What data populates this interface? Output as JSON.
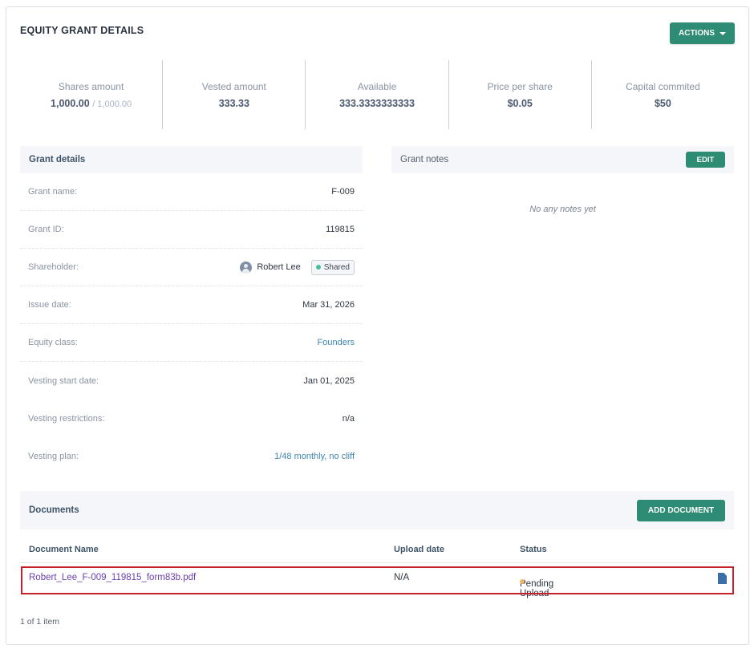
{
  "card": {
    "title": "EQUITY GRANT DETAILS",
    "actions_label": "ACTIONS"
  },
  "stats": [
    {
      "label": "Shares amount",
      "value": "1,000.00",
      "sub": "/ 1,000.00"
    },
    {
      "label": "Vested amount",
      "value": "333.33"
    },
    {
      "label": "Available",
      "value": "333.3333333333"
    },
    {
      "label": "Price per share",
      "value": "$0.05"
    },
    {
      "label": "Capital commited",
      "value": "$50"
    }
  ],
  "grant_details": {
    "title": "Grant details",
    "rows": [
      {
        "label": "Grant name:",
        "value": "F-009"
      },
      {
        "label": "Grant ID:",
        "value": "119815"
      },
      {
        "label": "Shareholder:",
        "value": "Robert Lee",
        "badge": "Shared"
      },
      {
        "label": "Issue date:",
        "value": "Mar 31, 2026"
      },
      {
        "label": "Equity class:",
        "value": "Founders"
      },
      {
        "label": "Vesting start date:",
        "value": "Jan 01, 2025"
      },
      {
        "label": "Vesting restrictions:",
        "value": "n/a"
      },
      {
        "label": "Vesting plan:",
        "value": "1/48 monthly, no cliff"
      }
    ]
  },
  "grant_notes": {
    "title": "Grant notes",
    "edit_label": "EDIT",
    "empty_text": "No any notes yet"
  },
  "documents": {
    "title": "Documents",
    "add_label": "ADD DOCUMENT",
    "columns": {
      "name": "Document Name",
      "upload_date": "Upload date",
      "status": "Status"
    },
    "rows": [
      {
        "name": "Robert_Lee_F-009_119815_form83b.pdf",
        "upload_date": "N/A",
        "status": "Pending Upload",
        "status_color": "#f0b46a",
        "icon": "file-icon"
      }
    ],
    "pager": "1 of 1 item"
  },
  "colors": {
    "accent": "#2e8b74",
    "link": "#3d86b0",
    "doc_link": "#6a3fb0",
    "shared_dot": "#4bbf9a",
    "highlight": "#c81f2d"
  }
}
